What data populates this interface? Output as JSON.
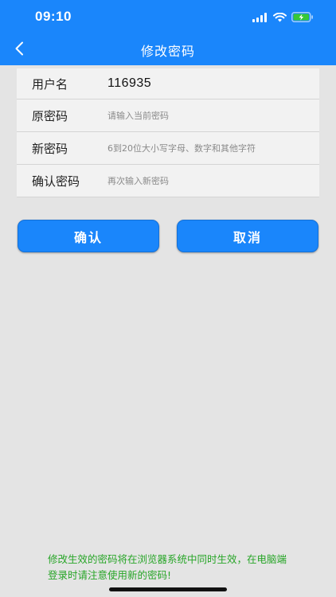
{
  "status_bar": {
    "time": "09:10",
    "icons": [
      "signal-icon",
      "wifi-icon",
      "battery-charging-icon"
    ]
  },
  "nav": {
    "back_icon": "chevron-left-icon",
    "title": "修改密码"
  },
  "form": {
    "username": {
      "label": "用户名",
      "value": "116935"
    },
    "old_password": {
      "label": "原密码",
      "placeholder": "请输入当前密码"
    },
    "new_password": {
      "label": "新密码",
      "placeholder": "6到20位大小写字母、数字和其他字符"
    },
    "confirm_password": {
      "label": "确认密码",
      "placeholder": "再次输入新密码"
    }
  },
  "buttons": {
    "confirm": "确认",
    "cancel": "取消"
  },
  "notice": {
    "text": "修改生效的密码将在浏览器系统中同时生效，在电脑端登录时请注意使用新的密码!"
  },
  "colors": {
    "primary": "#1a86fb",
    "background": "#e4e4e4",
    "notice_text": "#27a527",
    "battery_charging": "#37c837"
  }
}
